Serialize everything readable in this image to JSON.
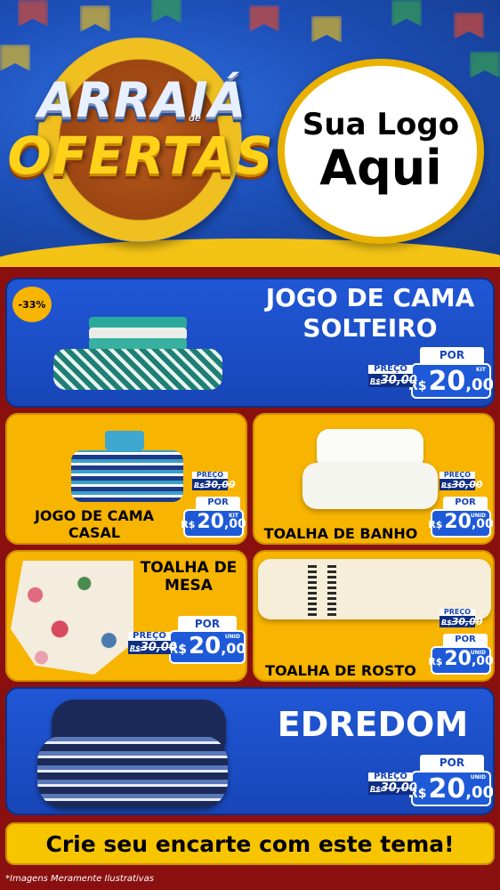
{
  "header": {
    "badge_line1": "ARRAIÁ",
    "badge_de": "de",
    "badge_line2": "OFERTAS",
    "logo_line1": "Sua Logo",
    "logo_line2": "Aqui"
  },
  "products": [
    {
      "title_line1": "JOGO DE CAMA",
      "title_line2": "SOLTEIRO",
      "discount": "-33%",
      "old_label": "PREÇO",
      "old_price": "30,00",
      "old_currency": "R$",
      "por_label": "POR",
      "currency": "R$",
      "price_int": "20",
      "price_cents": ",00",
      "unit": "KIT"
    },
    {
      "title_line1": "JOGO DE CAMA",
      "title_line2": "CASAL",
      "old_label": "PREÇO",
      "old_price": "30,00",
      "old_currency": "R$",
      "por_label": "POR",
      "currency": "R$",
      "price_int": "20",
      "price_cents": ",00",
      "unit": "KIT"
    },
    {
      "title_line1": "TOALHA DE BANHO",
      "old_label": "PREÇO",
      "old_price": "30,00",
      "old_currency": "R$",
      "por_label": "POR",
      "currency": "R$",
      "price_int": "20",
      "price_cents": ",00",
      "unit": "UNID"
    },
    {
      "title_line1": "TOALHA DE",
      "title_line2": "MESA",
      "old_label": "PREÇO",
      "old_price": "30,00",
      "old_currency": "R$",
      "por_label": "POR",
      "currency": "R$",
      "price_int": "20",
      "price_cents": ",00",
      "unit": "UNID"
    },
    {
      "title_line1": "TOALHA DE ROSTO",
      "old_label": "PREÇO",
      "old_price": "30,00",
      "old_currency": "R$",
      "por_label": "POR",
      "currency": "R$",
      "price_int": "20",
      "price_cents": ",00",
      "unit": "UNID"
    },
    {
      "title_line1": "EDREDOM",
      "old_label": "PREÇO",
      "old_price": "30,00",
      "old_currency": "R$",
      "por_label": "POR",
      "currency": "R$",
      "price_int": "20",
      "price_cents": ",00",
      "unit": "UNID"
    }
  ],
  "cta": "Crie seu encarte com este tema!",
  "footnote": "*Imagens Meramente Ilustrativas",
  "colors": {
    "blue": "#1e5ad8",
    "yellow": "#f7b400",
    "red_bg": "#8a1010",
    "white": "#ffffff"
  }
}
